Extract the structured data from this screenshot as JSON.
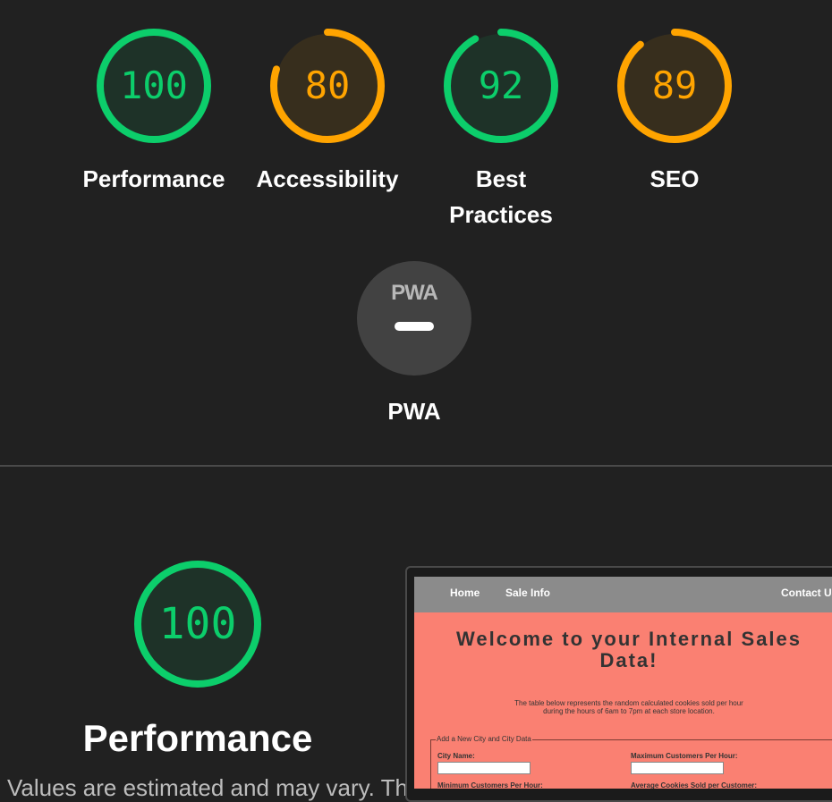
{
  "scores": [
    {
      "value": "100",
      "label": "Performance",
      "score": 100,
      "color": "#0cce6b"
    },
    {
      "value": "80",
      "label": "Accessibility",
      "score": 80,
      "color": "#ffa400"
    },
    {
      "value": "92",
      "label": "Best Practices",
      "score": 92,
      "color": "#0cce6b"
    },
    {
      "value": "89",
      "label": "SEO",
      "score": 89,
      "color": "#ffa400"
    }
  ],
  "pwa": {
    "badge": "PWA",
    "label": "PWA"
  },
  "performance_section": {
    "score": "100",
    "score_value": 100,
    "title": "Performance",
    "description": "Values are estimated and may vary. The"
  },
  "thumbnail": {
    "nav": {
      "home": "Home",
      "sale_info": "Sale Info",
      "contact": "Contact Us"
    },
    "title": "Welcome to your Internal Sales Data!",
    "subtitle": "The table below represents the random calculated cookies sold per hour during the hours of 6am to 7pm at each store location.",
    "legend": "Add a New City and City Data",
    "fields": {
      "city_name": "City Name:",
      "max_customers": "Maximum Customers Per Hour:",
      "min_customers": "Minimum Customers Per Hour:",
      "avg_cookies": "Average Cookies Sold per Customer:"
    }
  },
  "colors": {
    "pass": "#0cce6b",
    "average": "#ffa400",
    "background": "#212121"
  }
}
